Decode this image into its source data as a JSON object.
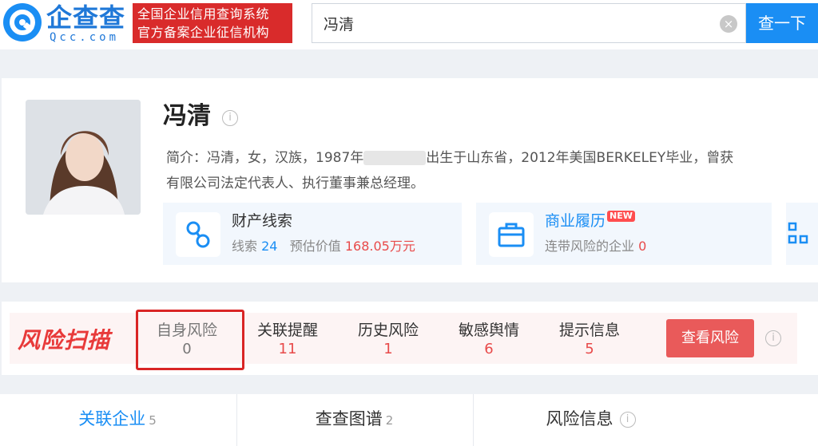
{
  "header": {
    "logo_name": "企查查",
    "logo_domain": "Qcc.com",
    "banner_line1": "全国企业信用查询系统",
    "banner_line2": "官方备案企业征信机构",
    "search_value": "冯清",
    "clear_icon": "×",
    "search_button": "查一下"
  },
  "profile": {
    "name": "冯清",
    "info_icon": "i",
    "intro_line1_a": "简介：冯清，女，汉族，1987年",
    "intro_line1_b": "出生于山东省，2012年美国BERKELEY毕业，曾获",
    "intro_line2": "有限公司法定代表人、执行董事兼总经理。",
    "cards": [
      {
        "title": "财产线索",
        "desc_a": "线索",
        "desc_a_val": "24",
        "desc_b": "预估价值",
        "desc_b_val": "168.05万元"
      },
      {
        "title": "商业履历",
        "badge": "NEW",
        "desc": "连带风险的企业",
        "desc_val": "0"
      }
    ]
  },
  "risk_scan": {
    "logo": "风险扫描",
    "items": [
      {
        "label": "自身风险",
        "value": "0"
      },
      {
        "label": "关联提醒",
        "value": "11"
      },
      {
        "label": "历史风险",
        "value": "1"
      },
      {
        "label": "敏感舆情",
        "value": "6"
      },
      {
        "label": "提示信息",
        "value": "5"
      }
    ],
    "button": "查看风险",
    "info_icon": "i"
  },
  "tabs": [
    {
      "label": "关联企业",
      "count": "5"
    },
    {
      "label": "查查图谱",
      "count": "2"
    },
    {
      "label": "风险信息",
      "info_icon": "i"
    }
  ],
  "colors": {
    "brand_blue": "#1a8ef4",
    "banner_red": "#d92b2b",
    "risk_red": "#e84a4a"
  }
}
